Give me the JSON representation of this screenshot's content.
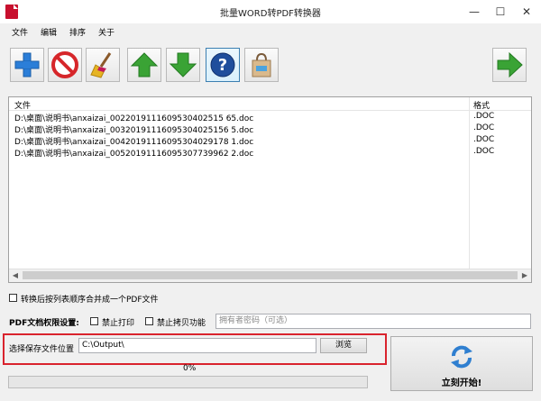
{
  "window": {
    "title": "批量WORD转PDF转换器",
    "minimize": "—",
    "maximize": "☐",
    "close": "✕"
  },
  "menu": [
    "文件",
    "编辑",
    "排序",
    "关于"
  ],
  "toolbar": {
    "icons": [
      "add-icon",
      "remove-icon",
      "clear-broom-icon",
      "move-up-icon",
      "move-down-icon",
      "help-icon",
      "shopping-bag-icon",
      "next-arrow-icon"
    ]
  },
  "file_list": {
    "headers": {
      "file": "文件",
      "format": "格式"
    },
    "rows": [
      {
        "path": "D:\\桌面\\说明书\\anxaizai_0022019111609530402515 65.doc",
        "format": ".DOC"
      },
      {
        "path": "D:\\桌面\\说明书\\anxaizai_00320191116095304025156 5.doc",
        "format": ".DOC"
      },
      {
        "path": "D:\\桌面\\说明书\\anxaizai_00420191116095304029178 1.doc",
        "format": ".DOC"
      },
      {
        "path": "D:\\桌面\\说明书\\anxaizai_00520191116095307739962 2.doc",
        "format": ".DOC"
      }
    ]
  },
  "merge_option": {
    "label": "转换后按列表顺序合并成一个PDF文件",
    "checked": false
  },
  "pdf_permissions": {
    "section_label": "PDF文档权限设置:",
    "no_print_label": "禁止打印",
    "no_copy_label": "禁止拷贝功能",
    "owner_password_placeholder": "拥有者密码（可选）"
  },
  "output": {
    "label": "选择保存文件位置",
    "path": "C:\\Output\\",
    "browse_label": "浏览"
  },
  "progress": {
    "text": "0%",
    "value": 0
  },
  "start_button": {
    "label": "立刻开始!"
  },
  "colors": {
    "highlight": "#d9232d",
    "add": "#2b7ed8",
    "remove": "#d6262a",
    "arrow_green": "#3aa335"
  }
}
